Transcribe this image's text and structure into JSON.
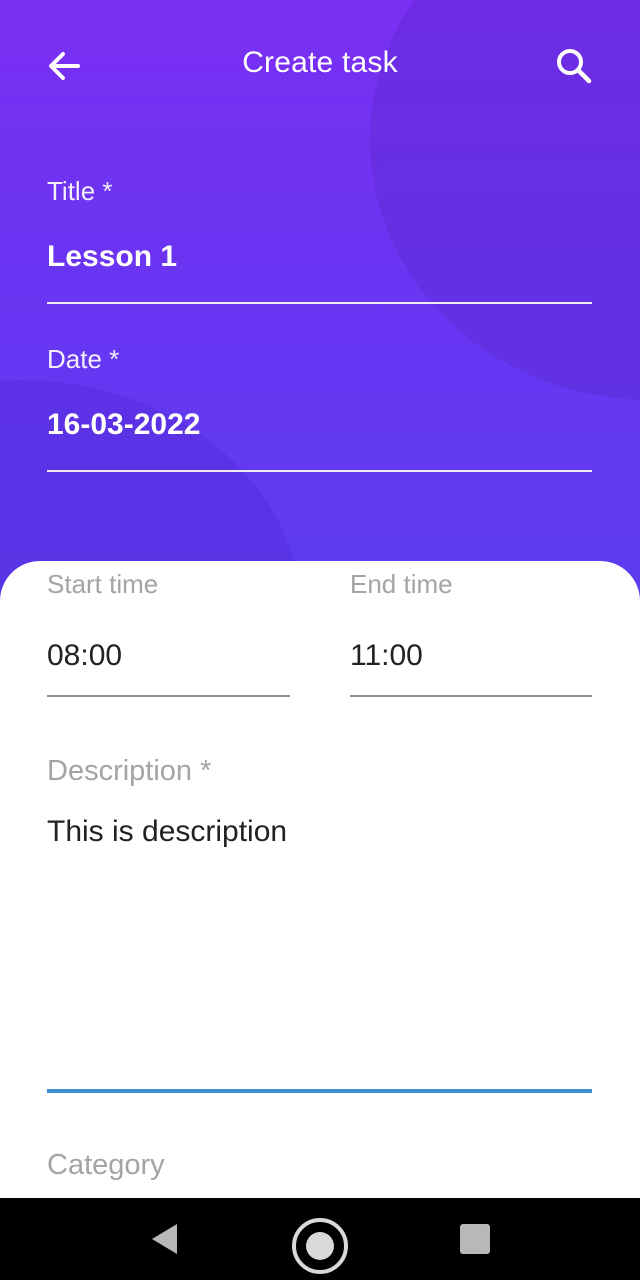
{
  "appbar": {
    "title": "Create task",
    "back_icon": "arrow-left-icon",
    "search_icon": "search-icon"
  },
  "form": {
    "title_label": "Title *",
    "title_value": "Lesson 1",
    "date_label": "Date *",
    "date_value": "16-03-2022",
    "start_label": "Start time",
    "start_value": "08:00",
    "end_label": "End time",
    "end_value": "11:00",
    "description_label": "Description *",
    "description_value": "This is description",
    "category_label": "Category"
  },
  "navbar": {
    "back_icon": "triangle-back-icon",
    "home_icon": "circle-home-icon",
    "recents_icon": "square-recents-icon"
  },
  "colors": {
    "gradient_top": "#7b2ff3",
    "gradient_bottom": "#5b3cf0",
    "focus_line": "#3d8fd6"
  }
}
